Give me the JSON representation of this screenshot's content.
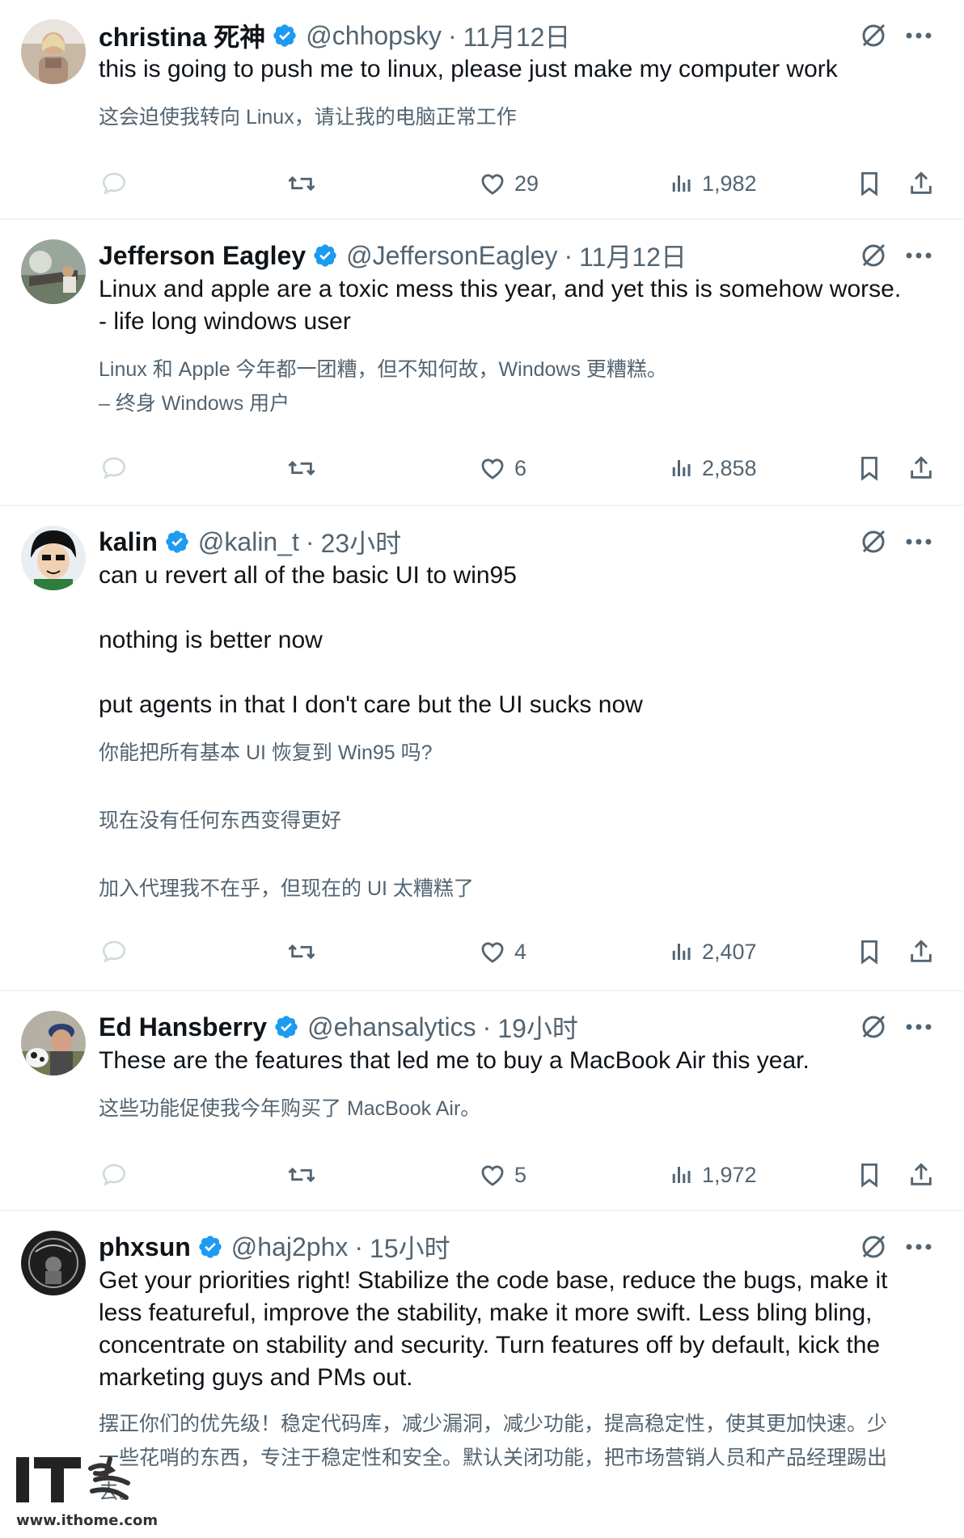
{
  "tweets": [
    {
      "name": "christina 死神",
      "handle": "@chhopsky",
      "time": "11月12日",
      "body": [
        "this is going to push me to linux, please just make my computer work"
      ],
      "translation": [
        "这会迫使我转向 Linux，请让我的电脑正常工作"
      ],
      "likes": "29",
      "views": "1,982"
    },
    {
      "name": "Jefferson Eagley",
      "handle": "@JeffersonEagley",
      "time": "11月12日",
      "body": [
        "Linux and apple are a toxic mess this year, and yet this is somehow worse.",
        "- life long windows user"
      ],
      "translation": [
        "Linux 和 Apple 今年都一团糟，但不知何故，Windows 更糟糕。",
        "– 终身 Windows 用户"
      ],
      "likes": "6",
      "views": "2,858"
    },
    {
      "name": "kalin",
      "handle": "@kalin_t",
      "time": "23小时",
      "body": [
        "can u revert all of the basic UI to win95",
        "nothing is better now",
        "put agents in that I don't care but the UI sucks now"
      ],
      "translation": [
        "你能把所有基本 UI 恢复到 Win95 吗?",
        "现在没有任何东西变得更好",
        "加入代理我不在乎，但现在的 UI 太糟糕了"
      ],
      "likes": "4",
      "views": "2,407"
    },
    {
      "name": "Ed Hansberry",
      "handle": "@ehansalytics",
      "time": "19小时",
      "body": [
        "These are the features that led me to buy a MacBook Air this year."
      ],
      "translation": [
        "这些功能促使我今年购买了 MacBook Air。"
      ],
      "likes": "5",
      "views": "1,972"
    },
    {
      "name": "phxsun",
      "handle": "@haj2phx",
      "time": "15小时",
      "body": [
        "Get your priorities right! Stabilize the code base, reduce the bugs, make it",
        "less featureful, improve the stability, make it more swift. Less bling bling,",
        "concentrate on stability and security.  Turn features off by default, kick the",
        "marketing guys and PMs out."
      ],
      "translation": [
        "摆正你们的优先级！稳定代码库，减少漏洞，减少功能，提高稳定性，使其更加快速。少",
        "一些花哨的东西，专注于稳定性和安全。默认关闭功能，把市场营销人员和产品经理踢出",
        "去。"
      ]
    }
  ],
  "separator": "·",
  "icons": {
    "verified": "verified-badge-icon",
    "grok": "grok-icon",
    "more": "more-icon",
    "reply": "reply-icon",
    "retweet": "retweet-icon",
    "like": "heart-icon",
    "views": "views-icon",
    "bookmark": "bookmark-icon",
    "share": "share-icon"
  },
  "colors": {
    "verified": "#1d9bf0",
    "text": "#0f1419",
    "secondary": "#536471",
    "border": "#eff3f4"
  },
  "watermark": {
    "logo": "IT之家",
    "url": "www.ithome.com"
  }
}
